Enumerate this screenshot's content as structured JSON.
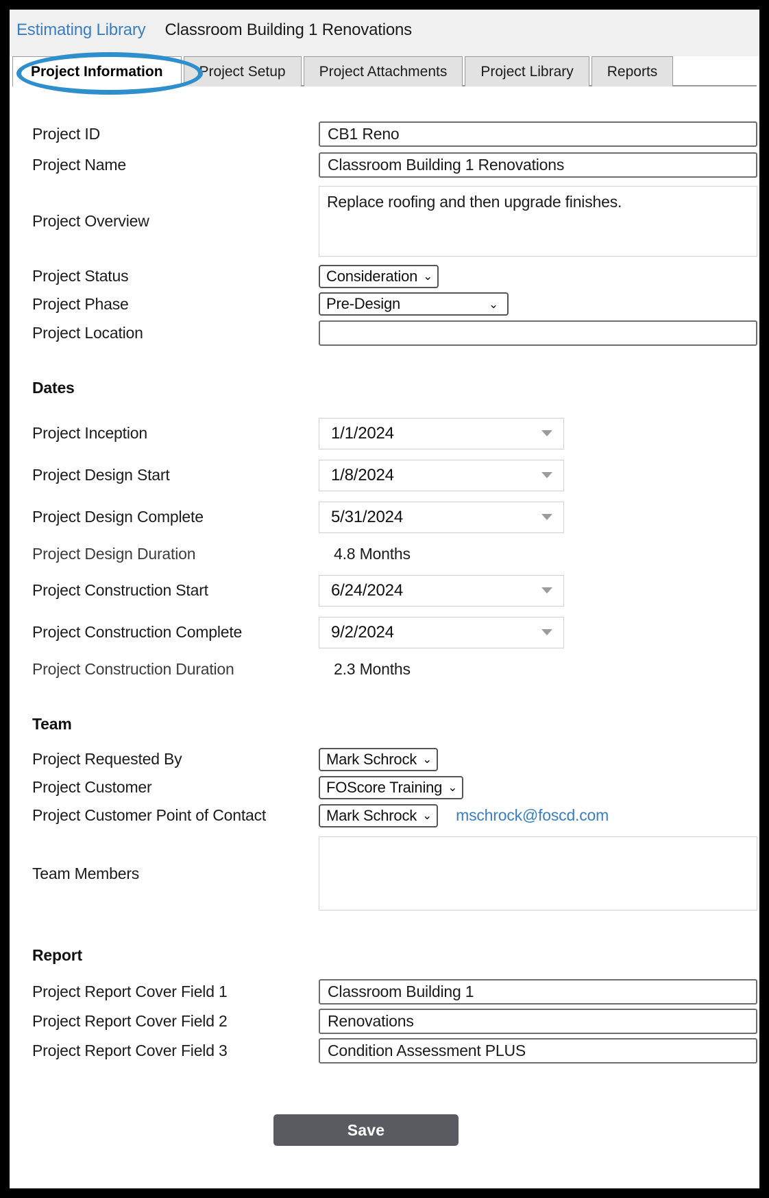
{
  "header": {
    "breadcrumb_link": "Estimating Library",
    "breadcrumb_current": "Classroom Building 1 Renovations"
  },
  "tabs": [
    {
      "label": "Project Information",
      "active": true
    },
    {
      "label": "Project Setup",
      "active": false
    },
    {
      "label": "Project Attachments",
      "active": false
    },
    {
      "label": "Project Library",
      "active": false
    },
    {
      "label": "Reports",
      "active": false
    }
  ],
  "form": {
    "project_id": {
      "label": "Project ID",
      "value": "CB1 Reno"
    },
    "project_name": {
      "label": "Project Name",
      "value": "Classroom Building 1 Renovations"
    },
    "project_overview": {
      "label": "Project Overview",
      "value": "Replace roofing and then upgrade finishes."
    },
    "project_status": {
      "label": "Project Status",
      "value": "Consideration"
    },
    "project_phase": {
      "label": "Project Phase",
      "value": "Pre-Design"
    },
    "project_location": {
      "label": "Project Location",
      "value": ""
    }
  },
  "dates": {
    "section_title": "Dates",
    "inception": {
      "label": "Project Inception",
      "value": "1/1/2024"
    },
    "design_start": {
      "label": "Project Design Start",
      "value": "1/8/2024"
    },
    "design_complete": {
      "label": "Project Design Complete",
      "value": "5/31/2024"
    },
    "design_duration": {
      "label": "Project Design Duration",
      "value": "4.8 Months"
    },
    "construction_start": {
      "label": "Project Construction Start",
      "value": "6/24/2024"
    },
    "construction_complete": {
      "label": "Project Construction Complete",
      "value": "9/2/2024"
    },
    "construction_duration": {
      "label": "Project Construction Duration",
      "value": "2.3 Months"
    }
  },
  "team": {
    "section_title": "Team",
    "requested_by": {
      "label": "Project Requested By",
      "value": "Mark Schrock"
    },
    "customer": {
      "label": "Project Customer",
      "value": "FOScore Training"
    },
    "point_of_contact": {
      "label": "Project Customer Point of Contact",
      "value": "Mark Schrock",
      "email": "mschrock@foscd.com"
    },
    "members": {
      "label": "Team Members",
      "value": ""
    }
  },
  "report": {
    "section_title": "Report",
    "cover_field_1": {
      "label": "Project Report Cover Field 1",
      "value": "Classroom Building 1"
    },
    "cover_field_2": {
      "label": "Project Report Cover Field 2",
      "value": "Renovations"
    },
    "cover_field_3": {
      "label": "Project Report Cover Field 3",
      "value": "Condition Assessment PLUS"
    }
  },
  "actions": {
    "save_label": "Save"
  },
  "icons": {
    "chevron_down": "⌄",
    "highlight_color": "#2f8fcd",
    "link_color": "#3a7ec0",
    "save_color": "#595b60"
  }
}
